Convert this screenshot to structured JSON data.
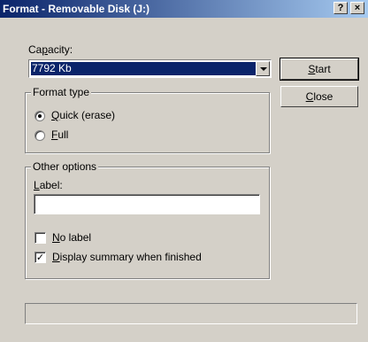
{
  "window": {
    "title": "Format - Removable Disk (J:)",
    "help_button": "?",
    "close_button": "×"
  },
  "capacity": {
    "label_pre": "Ca",
    "label_accel": "p",
    "label_post": "acity:",
    "value": "7792 Kb"
  },
  "buttons": {
    "start_accel": "S",
    "start_rest": "tart",
    "close_accel": "C",
    "close_rest": "lose"
  },
  "format_type": {
    "title": "Format type",
    "quick_accel": "Q",
    "quick_rest": "uick (erase)",
    "quick_selected": true,
    "full_accel": "F",
    "full_rest": "ull",
    "full_selected": false
  },
  "other_options": {
    "title": "Other options",
    "label_accel": "L",
    "label_rest": "abel:",
    "label_value": "",
    "no_label_accel": "N",
    "no_label_rest": "o label",
    "no_label_checked": false,
    "summary_accel": "D",
    "summary_rest": "isplay summary when finished",
    "summary_checked": true
  },
  "status": {
    "text": ""
  },
  "colors": {
    "title_start": "#0a246a",
    "title_end": "#a6caf0",
    "face": "#d4d0c8",
    "selection": "#0a246a"
  }
}
